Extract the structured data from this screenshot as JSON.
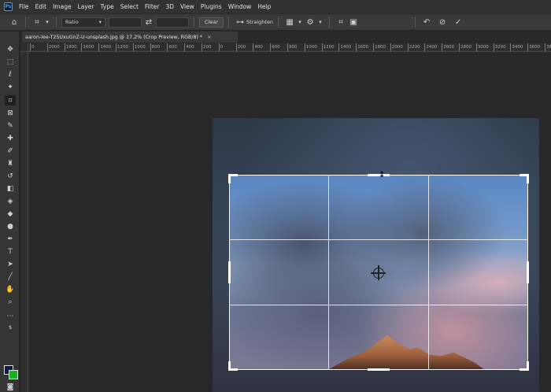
{
  "menubar": {
    "logo": "Ps",
    "items": [
      "File",
      "Edit",
      "Image",
      "Layer",
      "Type",
      "Select",
      "Filter",
      "3D",
      "View",
      "Plugins",
      "Window",
      "Help"
    ]
  },
  "options": {
    "ratio_label": "Ratio",
    "clear_label": "Clear",
    "straighten_label": "Straighten"
  },
  "document": {
    "tab_title": "aaron-lee-T25UxuGnZ-U-unsplash.jpg @ 17.2% (Crop Preview, RGB/8) *",
    "close_glyph": "×"
  },
  "ruler": {
    "ticks": [
      "0",
      "2000",
      "1800",
      "1600",
      "1400",
      "1200",
      "1000",
      "800",
      "600",
      "400",
      "200",
      "0",
      "200",
      "400",
      "600",
      "800",
      "1000",
      "1200",
      "1400",
      "1600",
      "1800",
      "2000",
      "2200",
      "2400",
      "2600",
      "2800",
      "3000",
      "3200",
      "3400",
      "3600",
      "3800"
    ]
  },
  "colors": {
    "foreground": "#0e1a3a",
    "background": "#19b31f",
    "accent": "#31a8ff"
  },
  "icons": {
    "home": "home-icon",
    "crop": "crop-icon",
    "swap": "swap-icon",
    "straighten": "level-icon",
    "grid": "overlay-grid-icon",
    "settings": "gear-icon",
    "delete_cropped": "delete-cropped-icon",
    "content_aware": "content-aware-icon",
    "reset": "reset-icon",
    "cancel": "cancel-icon",
    "commit": "checkmark-icon"
  }
}
